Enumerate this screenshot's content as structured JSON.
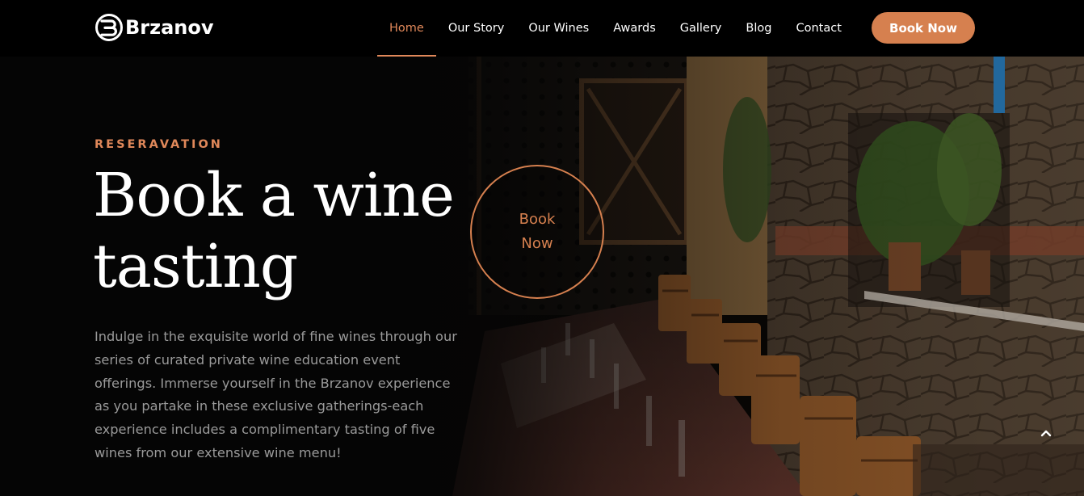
{
  "brand": {
    "name": "Brzanov",
    "logo_icon": "b-circle-logo-icon"
  },
  "nav": {
    "items": [
      {
        "label": "Home",
        "active": true
      },
      {
        "label": "Our Story",
        "active": false
      },
      {
        "label": "Our Wines",
        "active": false
      },
      {
        "label": "Awards",
        "active": false
      },
      {
        "label": "Gallery",
        "active": false
      },
      {
        "label": "Blog",
        "active": false
      },
      {
        "label": "Contact",
        "active": false
      }
    ],
    "cta_label": "Book Now"
  },
  "hero": {
    "eyebrow": "RESERAVATION",
    "title": "Book a wine tasting",
    "description": "Indulge in the exquisite world of fine wines through our series of curated private wine education event offerings. Immerse yourself in the Brzanov experience as you partake in these exclusive gatherings-each experience includes a complimentary tasting of five wines from our extensive wine menu!",
    "circle_button_label": "Book Now",
    "scroll_top_icon": "chevron-up-icon"
  },
  "colors": {
    "accent": "#d6804f",
    "accent_text": "#e0885a",
    "background": "#000000",
    "muted_text": "#9a9a9a"
  }
}
